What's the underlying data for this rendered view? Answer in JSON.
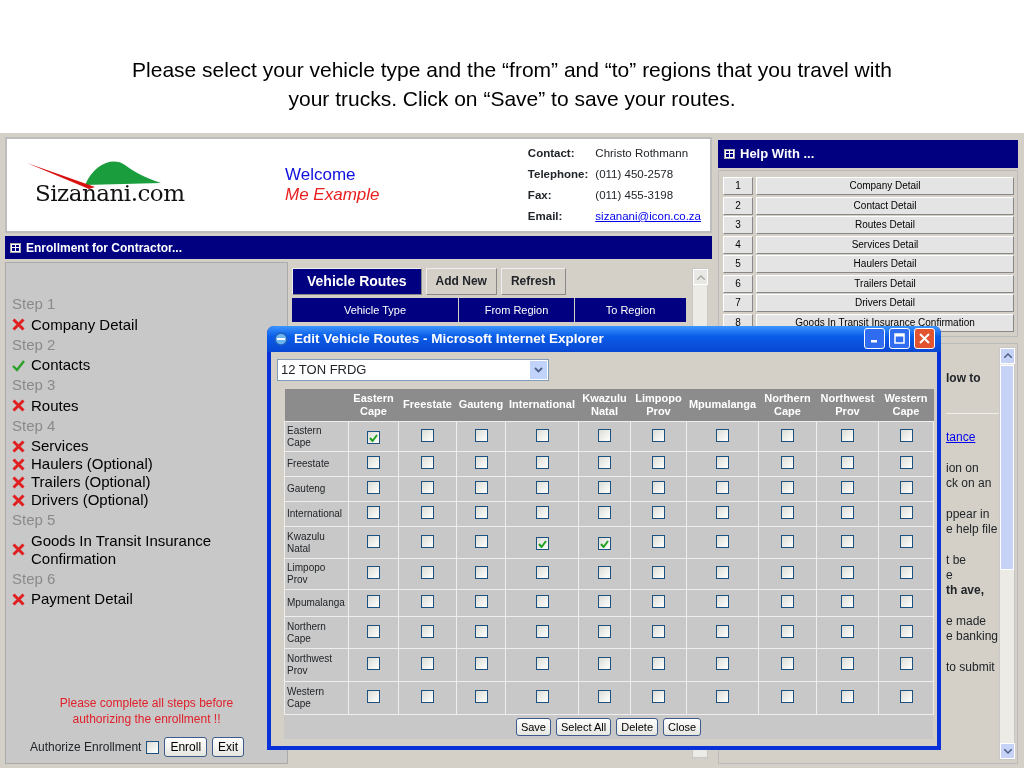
{
  "caption": "Please select your vehicle type and the “from” and “to” regions that you travel with your trucks. Click on “Save” to save your routes.",
  "header": {
    "logo": "Sizanani.com",
    "welcome": "Welcome",
    "user": "Me Example",
    "contacts": [
      {
        "label": "Contact:",
        "value": "Christo Rothmann",
        "kind": "text"
      },
      {
        "label": "Telephone:",
        "value": "(011) 450-2578",
        "kind": "text"
      },
      {
        "label": "Fax:",
        "value": "(011) 455-3198",
        "kind": "text"
      },
      {
        "label": "Email:",
        "value": "sizanani@icon.co.za",
        "kind": "link"
      }
    ]
  },
  "enrollment": {
    "title": "Enrollment for Contractor...",
    "steps": [
      {
        "label": "Step 1",
        "items": [
          {
            "label": "Company Detail",
            "done": false
          }
        ]
      },
      {
        "label": "Step 2",
        "items": [
          {
            "label": "Contacts",
            "done": true
          }
        ]
      },
      {
        "label": "Step 3",
        "items": [
          {
            "label": "Routes",
            "done": false
          }
        ]
      },
      {
        "label": "Step 4",
        "items": [
          {
            "label": "Services",
            "done": false
          },
          {
            "label": "Haulers (Optional)",
            "done": false
          },
          {
            "label": "Trailers (Optional)",
            "done": false
          },
          {
            "label": "Drivers (Optional)",
            "done": false
          }
        ]
      },
      {
        "label": "Step 5",
        "items": [
          {
            "label": "Goods In Transit Insurance Confirmation",
            "done": false
          }
        ]
      },
      {
        "label": "Step 6",
        "items": [
          {
            "label": "Payment Detail",
            "done": false
          }
        ]
      }
    ],
    "warning": "Please complete all steps before authorizing the enrollment !!",
    "authorize": {
      "label": "Authorize Enrollment",
      "checked": false
    },
    "buttons": [
      "Enroll",
      "Exit"
    ]
  },
  "routes": {
    "tabs": [
      {
        "label": "Vehicle Routes",
        "selected": true
      },
      {
        "label": "Add New",
        "selected": false
      },
      {
        "label": "Refresh",
        "selected": false
      }
    ],
    "columns": [
      "Vehicle Type",
      "From Region",
      "To Region"
    ]
  },
  "help": {
    "title": "Help With ...",
    "items": [
      {
        "number": "1",
        "label": "Company Detail"
      },
      {
        "number": "2",
        "label": "Contact Detail"
      },
      {
        "number": "3",
        "label": "Routes Detail"
      },
      {
        "number": "4",
        "label": "Services Detail"
      },
      {
        "number": "5",
        "label": "Haulers Detail"
      },
      {
        "number": "6",
        "label": "Trailers Detail"
      },
      {
        "number": "7",
        "label": "Drivers Detail"
      },
      {
        "number": "8",
        "label": "Goods In Transit Insurance Confirmation"
      }
    ],
    "paragraphs": [
      {
        "lines": [
          {
            "text": "low to",
            "kind": "bold"
          }
        ]
      },
      {
        "lines": [
          {
            "text": "tance",
            "kind": "link"
          }
        ]
      },
      {
        "lines": [
          {
            "text": "ion on",
            "kind": "text"
          },
          {
            "text": "ck on an",
            "kind": "text"
          }
        ]
      },
      {
        "lines": [
          {
            "text": "ppear in",
            "kind": "text"
          },
          {
            "text": "e help file",
            "kind": "text"
          }
        ]
      },
      {
        "lines": [
          {
            "text": "t be",
            "kind": "text"
          },
          {
            "text": "e",
            "kind": "text"
          },
          {
            "text": "th ave,",
            "kind": "bold"
          }
        ]
      },
      {
        "lines": [
          {
            "text": "e made",
            "kind": "text"
          },
          {
            "text": "e banking",
            "kind": "text"
          }
        ]
      },
      {
        "lines": [
          {
            "text": "to submit",
            "kind": "text"
          }
        ]
      }
    ]
  },
  "dialog": {
    "title": "Edit Vehicle Routes - Microsoft Internet Explorer",
    "vehicle": "12 TON FRDG",
    "columns": [
      "Eastern Cape",
      "Freestate",
      "Gauteng",
      "International",
      "Kwazulu Natal",
      "Limpopo Prov",
      "Mpumalanga",
      "Northern Cape",
      "Northwest Prov",
      "Western Cape"
    ],
    "rows": [
      {
        "label": "Eastern Cape",
        "checks": [
          true,
          false,
          false,
          false,
          false,
          false,
          false,
          false,
          false,
          false
        ]
      },
      {
        "label": "Freestate",
        "checks": [
          false,
          false,
          false,
          false,
          false,
          false,
          false,
          false,
          false,
          false
        ]
      },
      {
        "label": "Gauteng",
        "checks": [
          false,
          false,
          false,
          false,
          false,
          false,
          false,
          false,
          false,
          false
        ]
      },
      {
        "label": "International",
        "checks": [
          false,
          false,
          false,
          false,
          false,
          false,
          false,
          false,
          false,
          false
        ]
      },
      {
        "label": "Kwazulu Natal",
        "checks": [
          false,
          false,
          false,
          true,
          true,
          false,
          false,
          false,
          false,
          false
        ]
      },
      {
        "label": "Limpopo Prov",
        "checks": [
          false,
          false,
          false,
          false,
          false,
          false,
          false,
          false,
          false,
          false
        ]
      },
      {
        "label": "Mpumalanga",
        "checks": [
          false,
          false,
          false,
          false,
          false,
          false,
          false,
          false,
          false,
          false
        ]
      },
      {
        "label": "Northern Cape",
        "checks": [
          false,
          false,
          false,
          false,
          false,
          false,
          false,
          false,
          false,
          false
        ]
      },
      {
        "label": "Northwest Prov",
        "checks": [
          false,
          false,
          false,
          false,
          false,
          false,
          false,
          false,
          false,
          false
        ]
      },
      {
        "label": "Western Cape",
        "checks": [
          false,
          false,
          false,
          false,
          false,
          false,
          false,
          false,
          false,
          false
        ]
      }
    ],
    "buttons": [
      "Save",
      "Select All",
      "Delete",
      "Close"
    ]
  }
}
